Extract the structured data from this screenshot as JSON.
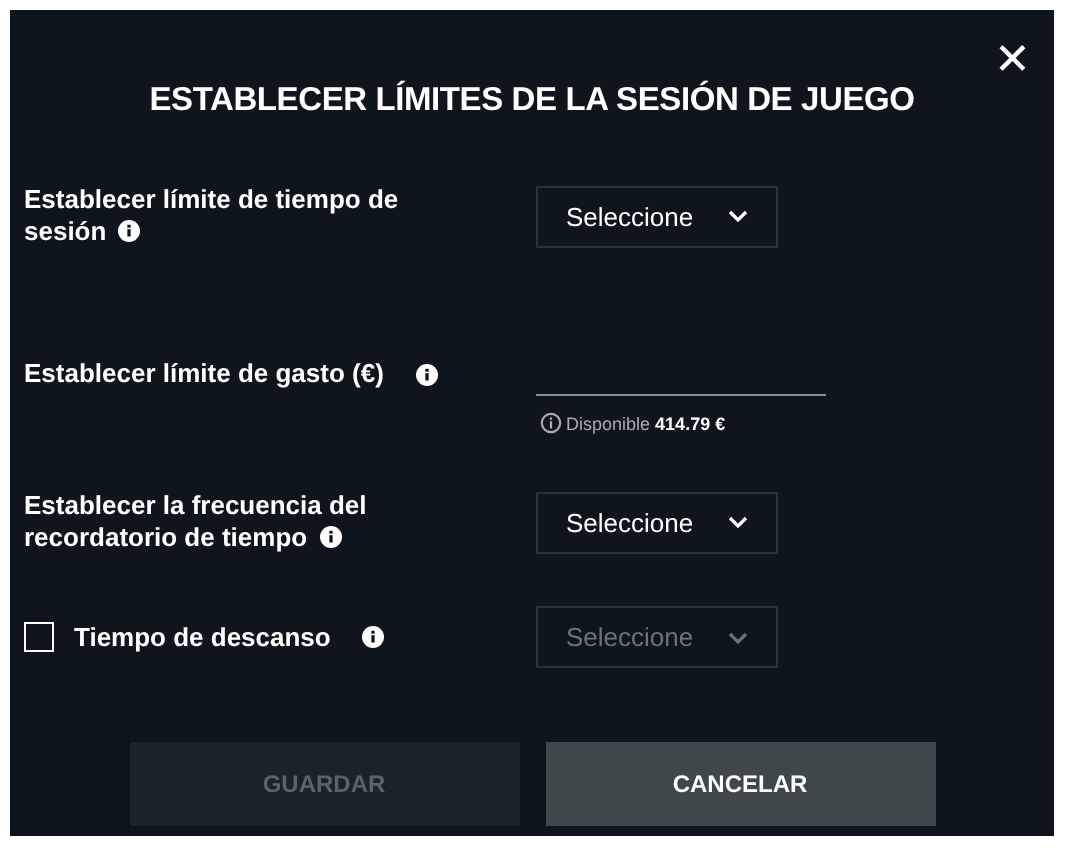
{
  "dialog": {
    "title": "ESTABLECER LÍMITES DE LA SESIÓN DE JUEGO",
    "close": "✕"
  },
  "rows": [
    {
      "kind": "select",
      "label": "Establecer límite de tiempo de sesión",
      "select": {
        "value": "Seleccione",
        "disabled": false
      }
    },
    {
      "kind": "input",
      "label": "Establecer límite de gasto (€)",
      "hint": {
        "label": "Disponible",
        "amount": "414.79 €"
      }
    },
    {
      "kind": "select",
      "label": "Establecer la frecuencia del recordatorio de tiempo",
      "select": {
        "value": "Seleccione",
        "disabled": false
      }
    },
    {
      "kind": "checkbox-select",
      "label": "Tiempo de descanso",
      "checked": false,
      "select": {
        "value": "Seleccione",
        "disabled": true
      }
    }
  ],
  "buttons": [
    {
      "label": "GUARDAR",
      "disabled": true
    },
    {
      "label": "CANCELAR",
      "disabled": false
    }
  ]
}
